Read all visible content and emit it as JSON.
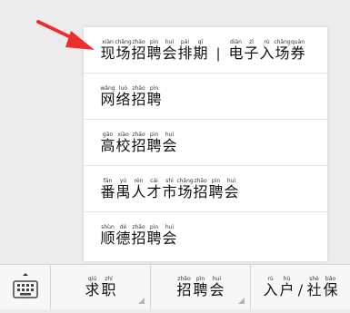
{
  "menu": {
    "items": [
      {
        "syllables": [
          {
            "py": "xiàn",
            "hz": "现"
          },
          {
            "py": "chǎng",
            "hz": "场"
          },
          {
            "py": "zhāo",
            "hz": "招"
          },
          {
            "py": "pìn",
            "hz": "聘"
          },
          {
            "py": "huì",
            "hz": "会"
          },
          {
            "py": "pái",
            "hz": "排"
          },
          {
            "py": "qī",
            "hz": "期"
          }
        ],
        "separator": "|",
        "syllables2": [
          {
            "py": "diàn",
            "hz": "电"
          },
          {
            "py": "zǐ",
            "hz": "子"
          },
          {
            "py": "rù",
            "hz": "入"
          },
          {
            "py": "chǎng",
            "hz": "场"
          },
          {
            "py": "quàn",
            "hz": "券"
          }
        ]
      },
      {
        "syllables": [
          {
            "py": "wǎng",
            "hz": "网"
          },
          {
            "py": "luò",
            "hz": "络"
          },
          {
            "py": "zhāo",
            "hz": "招"
          },
          {
            "py": "pìn",
            "hz": "聘"
          }
        ]
      },
      {
        "syllables": [
          {
            "py": "gāo",
            "hz": "高"
          },
          {
            "py": "xiào",
            "hz": "校"
          },
          {
            "py": "zhāo",
            "hz": "招"
          },
          {
            "py": "pìn",
            "hz": "聘"
          },
          {
            "py": "huì",
            "hz": "会"
          }
        ]
      },
      {
        "syllables": [
          {
            "py": "fān",
            "hz": "番"
          },
          {
            "py": "yú",
            "hz": "禺"
          },
          {
            "py": "rén",
            "hz": "人"
          },
          {
            "py": "cái",
            "hz": "才"
          },
          {
            "py": "shì",
            "hz": "市"
          },
          {
            "py": "chǎng",
            "hz": "场"
          },
          {
            "py": "zhāo",
            "hz": "招"
          },
          {
            "py": "pìn",
            "hz": "聘"
          },
          {
            "py": "huì",
            "hz": "会"
          }
        ]
      },
      {
        "syllables": [
          {
            "py": "shùn",
            "hz": "顺"
          },
          {
            "py": "dé",
            "hz": "德"
          },
          {
            "py": "zhāo",
            "hz": "招"
          },
          {
            "py": "pìn",
            "hz": "聘"
          },
          {
            "py": "huì",
            "hz": "会"
          }
        ]
      }
    ]
  },
  "toolbar": {
    "keyboard_icon": "keyboard-icon",
    "tabs": [
      {
        "syllables": [
          {
            "py": "qiú",
            "hz": "求"
          },
          {
            "py": "zhí",
            "hz": "职"
          }
        ]
      },
      {
        "syllables": [
          {
            "py": "zhāo",
            "hz": "招"
          },
          {
            "py": "pìn",
            "hz": "聘"
          },
          {
            "py": "huì",
            "hz": "会"
          }
        ]
      },
      {
        "syllables": [
          {
            "py": "rù",
            "hz": "入"
          },
          {
            "py": "hù",
            "hz": "户"
          }
        ],
        "separator": "/",
        "syllables2": [
          {
            "py": "shè",
            "hz": "社"
          },
          {
            "py": "bǎo",
            "hz": "保"
          }
        ]
      }
    ]
  },
  "colors": {
    "arrow": "#f02d2d"
  }
}
